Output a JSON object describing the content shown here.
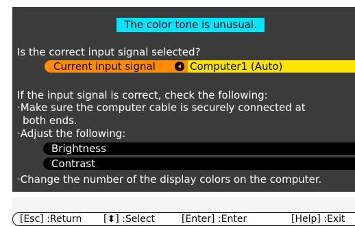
{
  "dialog": {
    "title": "The color tone is unusual.",
    "question": "Is the correct input signal selected?",
    "input_signal": {
      "label": "Current input signal",
      "icon": "enter-arrow-icon",
      "value": "Computer1 (Auto)"
    },
    "check_intro": "If the input signal is correct, check the following:",
    "cable_line1": "·Make sure the computer cable is securely connected at",
    "cable_line2": "both ends.",
    "adjust_intro": "·Adjust the following:",
    "adjust_items": [
      "Brightness",
      "Contrast"
    ],
    "colors_tip": "·Change the number of the display colors on the computer."
  },
  "help_bar": {
    "items": [
      "[Esc] :Return",
      "[⬍] :Select",
      "[Enter] :Enter",
      "[Help] :Exit"
    ]
  },
  "colors": {
    "panel_bg": "#3b3b3b",
    "title_highlight": "#00e5ff",
    "selection_orange": "#ff8c00",
    "value_yellow": "#ffe400"
  }
}
